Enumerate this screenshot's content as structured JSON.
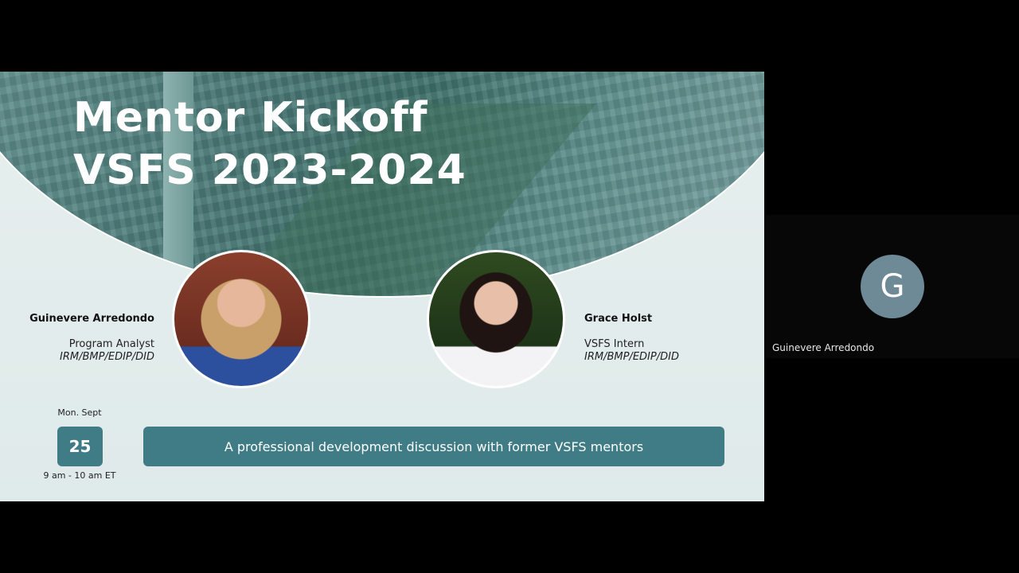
{
  "slide": {
    "title_line1": "Mentor Kickoff",
    "title_line2": "VSFS 2023-2024",
    "speakers": [
      {
        "name": "Guinevere Arredondo",
        "role": "Program Analyst",
        "office": "IRM/BMP/EDIP/DID"
      },
      {
        "name": "Grace Holst",
        "role": "VSFS Intern",
        "office": "IRM/BMP/EDIP/DID"
      }
    ],
    "date_label": "Mon. Sept",
    "date_day": "25",
    "time": "9 am - 10 am ET",
    "banner": "A professional development discussion with former VSFS mentors",
    "accent": "#3f7c86"
  },
  "participant": {
    "initial": "G",
    "name": "Guinevere Arredondo",
    "avatar_color": "#6e8a97"
  }
}
